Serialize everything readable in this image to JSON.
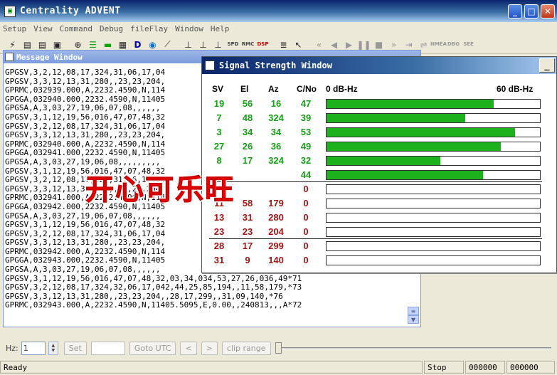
{
  "window": {
    "title": "Centrality ADVENT",
    "minimize": "_",
    "maximize": "□",
    "close": "✕"
  },
  "menu": [
    "Setup",
    "View",
    "Command",
    "Debug",
    "fileFlay",
    "Window",
    "Help"
  ],
  "toolbar": {
    "txt1": "SPD",
    "txt2": "RMC",
    "txt3": "DSP",
    "txt4": "NMEA",
    "txt5": "DBG",
    "txt6": "SEE"
  },
  "message_window": {
    "title": "Message Window",
    "lines": [
      "GPGSV,3,2,12,08,17,324,31,06,17,04",
      "GPGSV,3,3,12,13,31,280,,23,23,204,",
      "GPRMC,032939.000,A,2232.4590,N,114",
      "GPGGA,032940.000,2232.4590,N,11405",
      "GPGSA,A,3,03,27,19,06,07,08,,,,,,",
      "GPGSV,3,1,12,19,56,016,47,07,48,32",
      "GPGSV,3,2,12,08,17,324,31,06,17,04",
      "GPGSV,3,3,12,13,31,280,,23,23,204,",
      "GPRMC,032940.000,A,2232.4590,N,114",
      "GPGGA,032941.000,2232.4590,N,11405",
      "GPGSA,A,3,03,27,19,06,08,,,,,,,,,",
      "GPGSV,3,1,12,19,56,016,47,07,48,32",
      "GPGSV,3,2,12,08,17,324,31,06,17,04",
      "GPGSV,3,3,12,13,31,280,,23,23,204,",
      "GPRMC,032941.000,A,2232.4590,N,114",
      "GPGGA,032942.000,2232.4590,N,11405",
      "GPGSA,A,3,03,27,19,06,07,08,,,,,,",
      "GPGSV,3,1,12,19,56,016,47,07,48,32",
      "GPGSV,3,2,12,08,17,324,31,06,17,04",
      "GPGSV,3,3,12,13,31,280,,23,23,204,",
      "GPRMC,032942.000,A,2232.4590,N,114",
      "GPGGA,032943.000,2232.4590,N,11405",
      "GPGSA,A,3,03,27,19,06,07,08,,,,,,",
      "GPGSV,3,1,12,19,56,016,47,07,48,32,03,34,034,53,27,26,036,49*71",
      "GPGSV,3,2,12,08,17,324,32,06,17,042,44,25,85,194,,11,58,179,*73",
      "GPGSV,3,3,12,13,31,280,,23,23,204,,28,17,299,,31,09,140,*76",
      "GPRMC,032943.000,A,2232.4590,N,11405.5095,E,0.00,,240813,,,A*72"
    ]
  },
  "signal_window": {
    "title": "Signal Strength Window",
    "headers": {
      "sv": "SV",
      "el": "El",
      "az": "Az",
      "cno": "C/No",
      "scale_min": "0 dB-Hz",
      "scale_max": "60 dB-Hz"
    },
    "rows": [
      {
        "sv": "19",
        "el": "56",
        "az": "16",
        "cno": "47",
        "state": "green",
        "fraction": 0.783
      },
      {
        "sv": "7",
        "el": "48",
        "az": "324",
        "cno": "39",
        "state": "green",
        "fraction": 0.65
      },
      {
        "sv": "3",
        "el": "34",
        "az": "34",
        "cno": "53",
        "state": "green",
        "fraction": 0.883
      },
      {
        "sv": "27",
        "el": "26",
        "az": "36",
        "cno": "49",
        "state": "green",
        "fraction": 0.817
      },
      {
        "sv": "8",
        "el": "17",
        "az": "324",
        "cno": "32",
        "state": "green",
        "fraction": 0.533
      },
      {
        "sv": "",
        "el": "",
        "az": "",
        "cno": "44",
        "state": "green",
        "fraction": 0.733
      },
      {
        "sv": "",
        "el": "",
        "az": "",
        "cno": "0",
        "state": "red",
        "fraction": 0
      },
      {
        "sv": "11",
        "el": "58",
        "az": "179",
        "cno": "0",
        "state": "red",
        "fraction": 0
      },
      {
        "sv": "13",
        "el": "31",
        "az": "280",
        "cno": "0",
        "state": "red",
        "fraction": 0
      },
      {
        "sv": "23",
        "el": "23",
        "az": "204",
        "cno": "0",
        "state": "red",
        "fraction": 0
      },
      {
        "sv": "28",
        "el": "17",
        "az": "299",
        "cno": "0",
        "state": "red",
        "fraction": 0
      },
      {
        "sv": "31",
        "el": "9",
        "az": "140",
        "cno": "0",
        "state": "red",
        "fraction": 0
      }
    ],
    "colors": {
      "tracked": "#16a016",
      "untracked": "#a01515",
      "bar_fill": "#1db21d"
    }
  },
  "watermark": {
    "text": "开心可乐旺"
  },
  "controls": {
    "hz_label": "Hz:",
    "hz_value": "1",
    "set_label": "Set",
    "goto_utc_label": "Goto UTC",
    "prev_label": "<",
    "next_label": ">",
    "clip_range_label": "clip range"
  },
  "status": {
    "ready": "Ready",
    "state": "Stop",
    "count1": "000000",
    "count2": "000000"
  }
}
